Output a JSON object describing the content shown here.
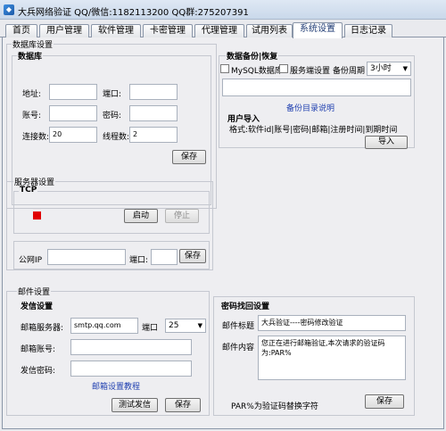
{
  "window": {
    "title": "大兵网络验证 QQ/微信:1182113200 QQ群:275207391"
  },
  "tabs": [
    "首页",
    "用户管理",
    "软件管理",
    "卡密管理",
    "代理管理",
    "试用列表",
    "系统设置",
    "日志记录"
  ],
  "db_settings": {
    "legend": "数据库设置",
    "group_title": "数据库",
    "address_label": "地址:",
    "address_value": "",
    "port_label": "端口:",
    "port_value": "",
    "account_label": "账号:",
    "account_value": "",
    "password_label": "密码:",
    "password_value": "",
    "connections_label": "连接数:",
    "connections_value": "20",
    "threads_label": "线程数:",
    "threads_value": "2",
    "save_label": "保存"
  },
  "backup": {
    "title": "数据备份|恢复",
    "mysql_label": "MySQL数据库",
    "server_label": "服务端设置",
    "period_label": "备份周期",
    "period_value": "3小时",
    "path_value": "",
    "dir_link": "备份目录说明",
    "import_title": "用户导入",
    "format_text": "格式:软件id|账号|密码|邮箱|注册时间|到期时间",
    "import_button": "导入"
  },
  "server": {
    "legend": "服务器设置",
    "group_title": "TCP",
    "start_button": "启动",
    "stop_button": "停止",
    "public_ip_label": "公网IP",
    "public_ip_value": "",
    "port_label": "端口:",
    "port_value": "",
    "save_label": "保存"
  },
  "mail": {
    "legend": "邮件设置",
    "send_title": "发信设置",
    "server_label": "邮箱服务器:",
    "server_value": "smtp.qq.com",
    "port_label": "端口",
    "port_value": "25",
    "account_label": "邮箱账号:",
    "account_value": "",
    "password_label": "发信密码:",
    "password_value": "",
    "tutorial_link": "邮箱设置教程",
    "test_button": "测试发信",
    "save_label": "保存"
  },
  "recovery": {
    "title": "密码找回设置",
    "subject_label": "邮件标题",
    "subject_value": "大兵验证----密码修改验证",
    "content_label": "邮件内容",
    "content_value": "您正在进行邮箱验证,本次请求的验证码为:PAR%",
    "hint": "PAR%为验证码替换字符",
    "save_label": "保存"
  },
  "colors": {
    "status_stopped": "#e00000",
    "link": "#1f3fb0",
    "active_tab": "#1f3b74"
  }
}
